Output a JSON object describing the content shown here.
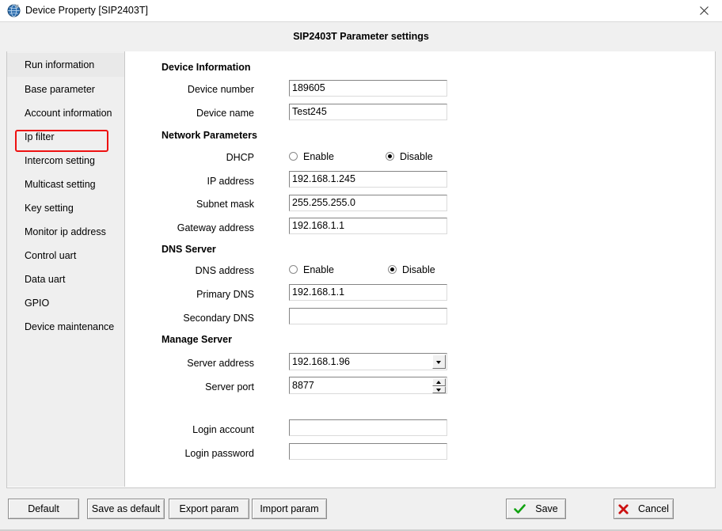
{
  "window": {
    "title": "Device Property [SIP2403T]",
    "icon": "network-globe-icon",
    "close_label": "✕"
  },
  "header": {
    "title": "SIP2403T Parameter settings"
  },
  "sidebar": {
    "items": [
      {
        "label": "Run information"
      },
      {
        "label": "Base parameter"
      },
      {
        "label": "Account information"
      },
      {
        "label": "Ip filter"
      },
      {
        "label": "Intercom setting"
      },
      {
        "label": "Multicast setting"
      },
      {
        "label": "Key setting"
      },
      {
        "label": "Monitor ip address"
      },
      {
        "label": "Control uart"
      },
      {
        "label": "Data uart"
      },
      {
        "label": "GPIO"
      },
      {
        "label": "Device maintenance"
      }
    ],
    "highlight_color": "#ee1111",
    "highlighted_item": "Base parameter"
  },
  "sections": {
    "device_information": {
      "heading": "Device Information",
      "device_number": {
        "label": "Device number",
        "value": "189605"
      },
      "device_name": {
        "label": "Device name",
        "value": "Test245"
      }
    },
    "network_parameters": {
      "heading": "Network Parameters",
      "dhcp": {
        "label": "DHCP",
        "enable_label": "Enable",
        "disable_label": "Disable",
        "selected": "Disable"
      },
      "ip_address": {
        "label": "IP address",
        "value": "192.168.1.245"
      },
      "subnet_mask": {
        "label": "Subnet mask",
        "value": "255.255.255.0"
      },
      "gateway_address": {
        "label": "Gateway address",
        "value": "192.168.1.1"
      }
    },
    "dns_server": {
      "heading": "DNS Server",
      "dns_address": {
        "label": "DNS address",
        "enable_label": "Enable",
        "disable_label": "Disable",
        "selected": "Disable"
      },
      "primary_dns": {
        "label": "Primary DNS",
        "value": "192.168.1.1"
      },
      "secondary_dns": {
        "label": "Secondary DNS",
        "value": ""
      }
    },
    "manage_server": {
      "heading": "Manage Server",
      "server_address": {
        "label": "Server address",
        "value": "192.168.1.96"
      },
      "server_port": {
        "label": "Server port",
        "value": "8877"
      },
      "login_account": {
        "label": "Login account",
        "value": ""
      },
      "login_password": {
        "label": "Login password",
        "value": ""
      }
    }
  },
  "footer": {
    "default_label": "Default",
    "save_as_default_label": "Save as default",
    "export_param_label": "Export param",
    "import_param_label": "Import param",
    "save_label": "Save",
    "cancel_label": "Cancel",
    "save_icon_color": "#11a211",
    "cancel_icon_color": "#cc1111"
  }
}
